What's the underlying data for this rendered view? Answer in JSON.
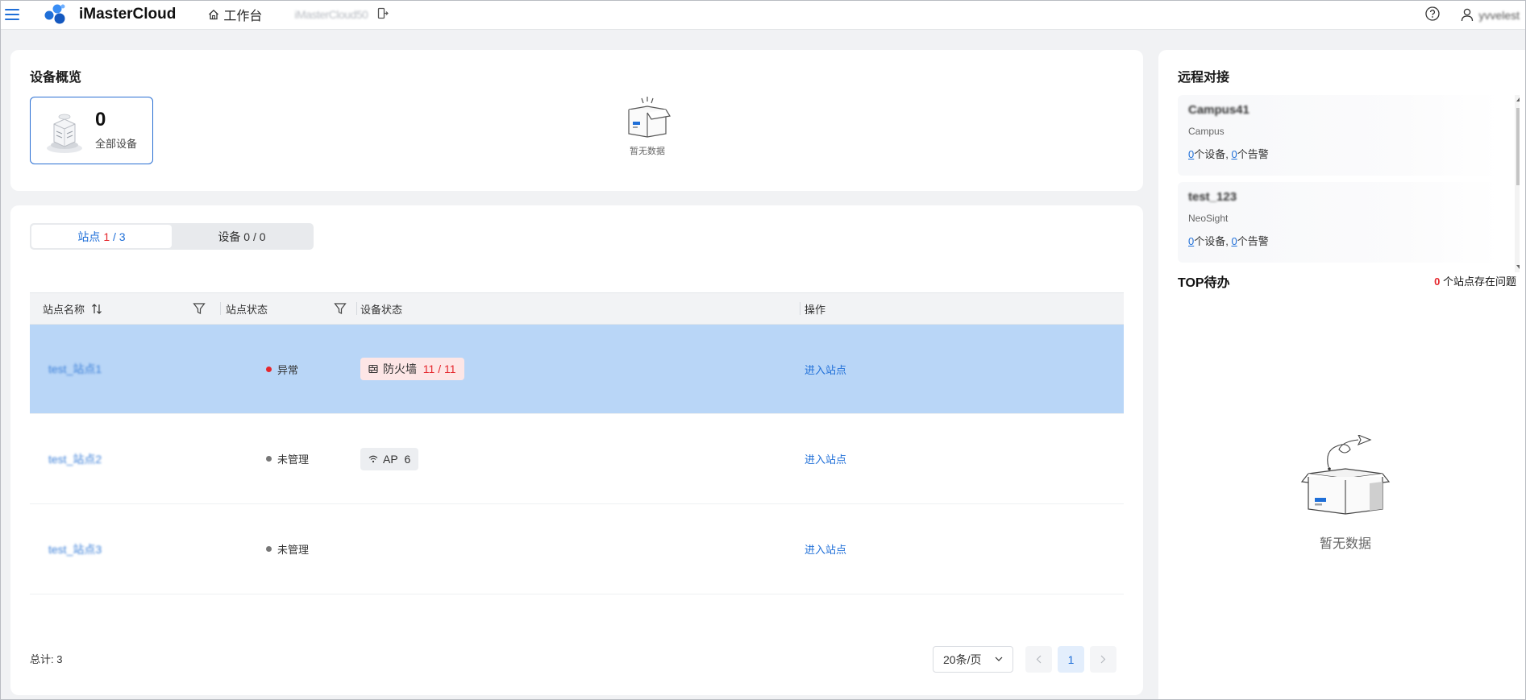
{
  "topbar": {
    "app_title": "iMasterCloud",
    "home_label": "工作台",
    "tenant_name": "iMasterCloud50",
    "user_name": "yvvelest",
    "icons": [
      "menu-icon",
      "home-icon",
      "exit-icon",
      "help-icon",
      "user-icon"
    ]
  },
  "overview": {
    "title": "设备概览",
    "device_count": "0",
    "device_label": "全部设备",
    "empty_text": "暂无数据"
  },
  "sites": {
    "tabs": [
      {
        "label": "站点",
        "current": "1",
        "sep": " / ",
        "total": "3"
      },
      {
        "label": "设备 0 / 0"
      }
    ],
    "columns": {
      "name": "站点名称",
      "status": "站点状态",
      "device_status": "设备状态",
      "action": "操作"
    },
    "rows": [
      {
        "name": "test_站点1",
        "status": "异常",
        "status_color": "#e5272d",
        "tag_type": "firewall",
        "tag_label": "防火墙",
        "tag_count": "11 / 11",
        "action": "进入站点",
        "selected": true
      },
      {
        "name": "test_站点2",
        "status": "未管理",
        "status_color": "#777777",
        "tag_type": "ap",
        "tag_label": "AP",
        "tag_count": "6",
        "action": "进入站点",
        "selected": false
      },
      {
        "name": "test_站点3",
        "status": "未管理",
        "status_color": "#777777",
        "tag_type": "",
        "tag_label": "",
        "tag_count": "",
        "action": "进入站点",
        "selected": false
      }
    ],
    "total_label": "总计: 3",
    "page_size": "20条/页",
    "current_page": "1"
  },
  "remote": {
    "title": "远程对接",
    "items": [
      {
        "name": "Campus41",
        "type": "Campus",
        "devices": "0",
        "devices_suffix": "个设备, ",
        "alarms": "0",
        "alarms_suffix": "个告警"
      },
      {
        "name": "test_123",
        "type": "NeoSight",
        "devices": "0",
        "devices_suffix": "个设备, ",
        "alarms": "0",
        "alarms_suffix": "个告警"
      }
    ],
    "todo_title": "TOP待办",
    "todo_count": "0",
    "todo_suffix": " 个站点存在问题",
    "empty_text": "暂无数据"
  },
  "colors": {
    "accent": "#1f6fd8",
    "danger": "#e5272d",
    "selected_row": "#b9d6f7"
  }
}
